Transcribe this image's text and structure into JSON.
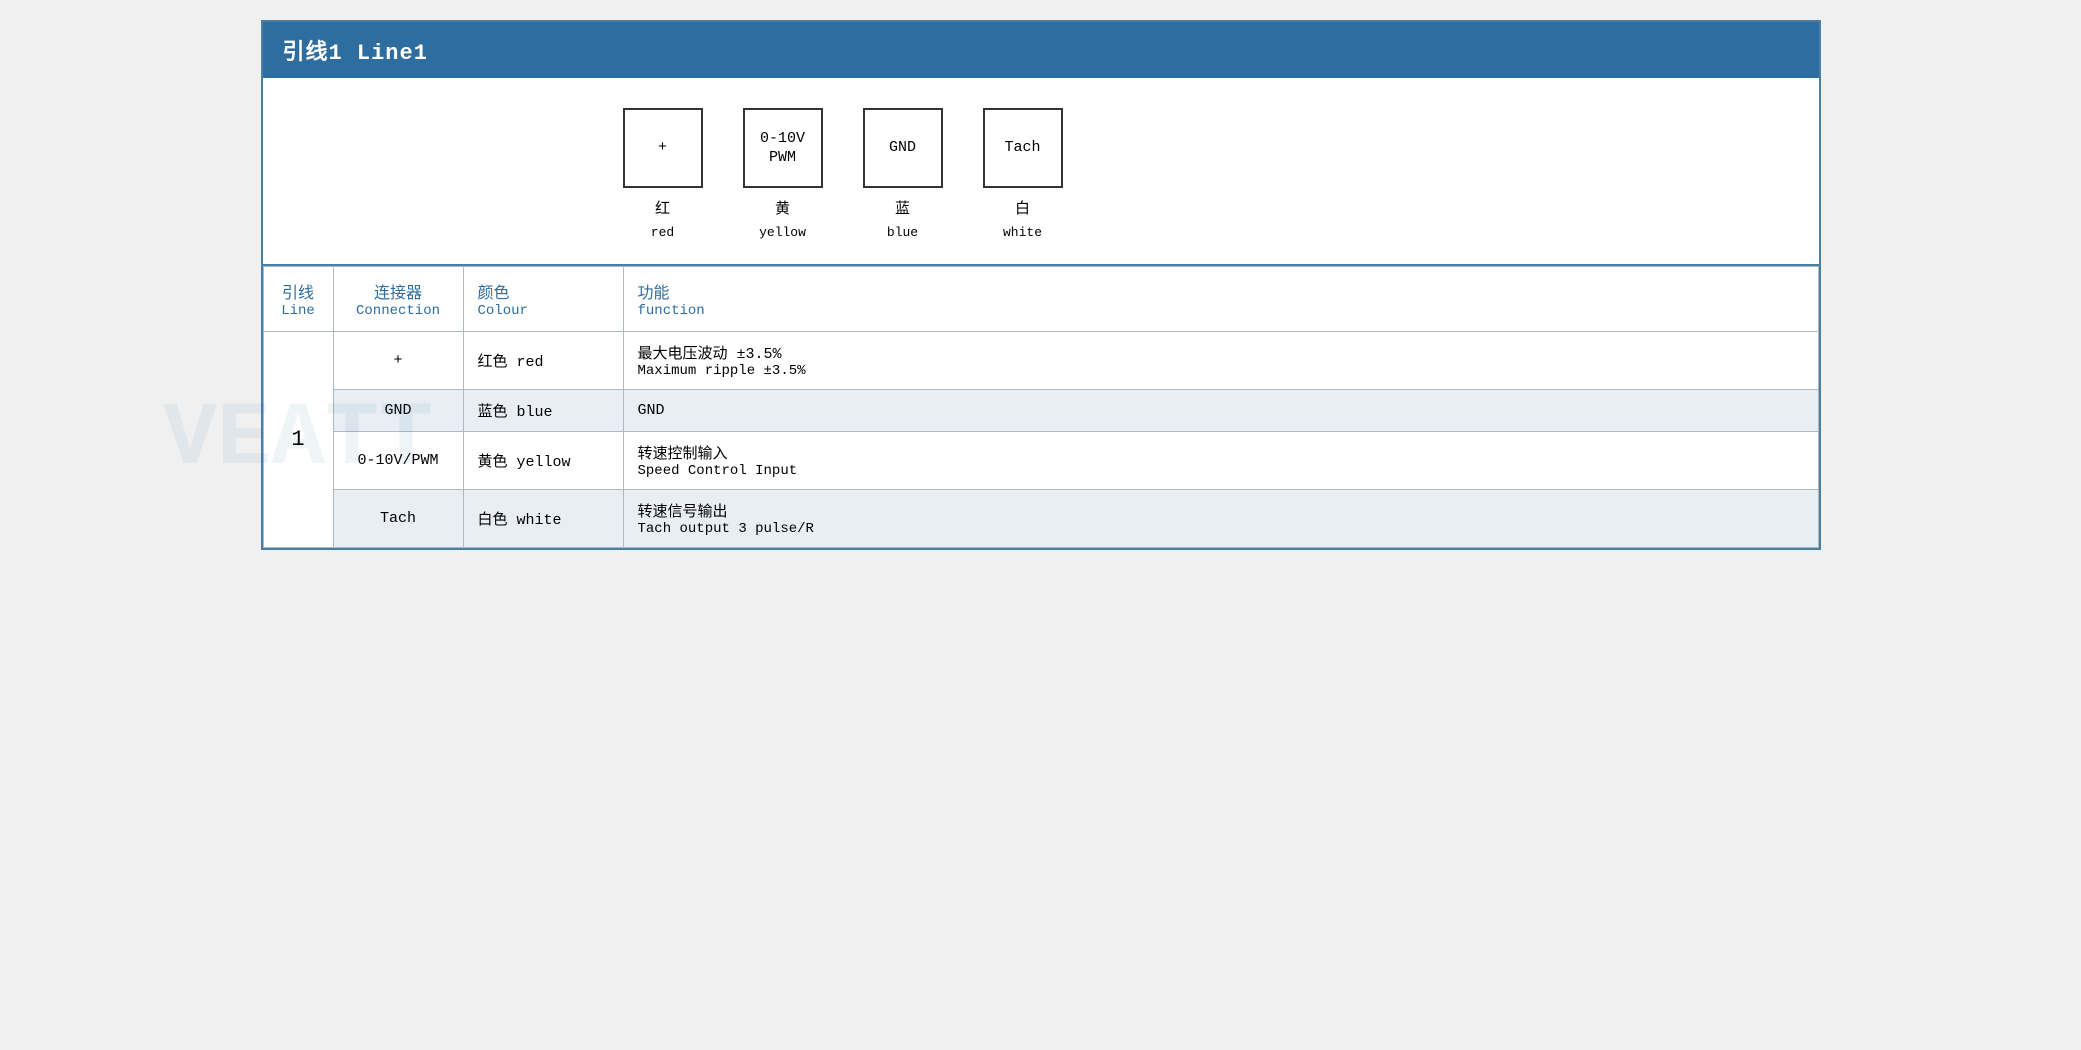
{
  "title": "引线1 Line1",
  "diagram": {
    "connectors": [
      {
        "symbol": "+",
        "label_zh": "红",
        "label_en": "red"
      },
      {
        "symbol": "0-10V\nPWM",
        "label_zh": "黄",
        "label_en": "yellow"
      },
      {
        "symbol": "GND",
        "label_zh": "蓝",
        "label_en": "blue"
      },
      {
        "symbol": "Tach",
        "label_zh": "白",
        "label_en": "white"
      }
    ]
  },
  "table": {
    "headers": {
      "line_zh": "引线",
      "line_en": "Line",
      "connection_zh": "连接器",
      "connection_en": "Connection",
      "colour_zh": "颜色",
      "colour_en": "Colour",
      "function_zh": "功能",
      "function_en": "function"
    },
    "rows": [
      {
        "line": "",
        "connection": "+",
        "colour_zh": "红色 red",
        "function_zh": "最大电压波动 ±3.5%",
        "function_en": "Maximum ripple ±3.5%",
        "alt": false
      },
      {
        "line": "",
        "connection": "GND",
        "colour_zh": "蓝色 blue",
        "function_zh": "GND",
        "function_en": "",
        "alt": true
      },
      {
        "line": "1",
        "connection": "0-10V/PWM",
        "colour_zh": "黄色 yellow",
        "function_zh": "转速控制输入",
        "function_en": "Speed Control Input",
        "alt": false
      },
      {
        "line": "",
        "connection": "Tach",
        "colour_zh": "白色 white",
        "function_zh": "转速信号输出",
        "function_en": "Tach output 3 pulse/R",
        "alt": true
      }
    ]
  }
}
